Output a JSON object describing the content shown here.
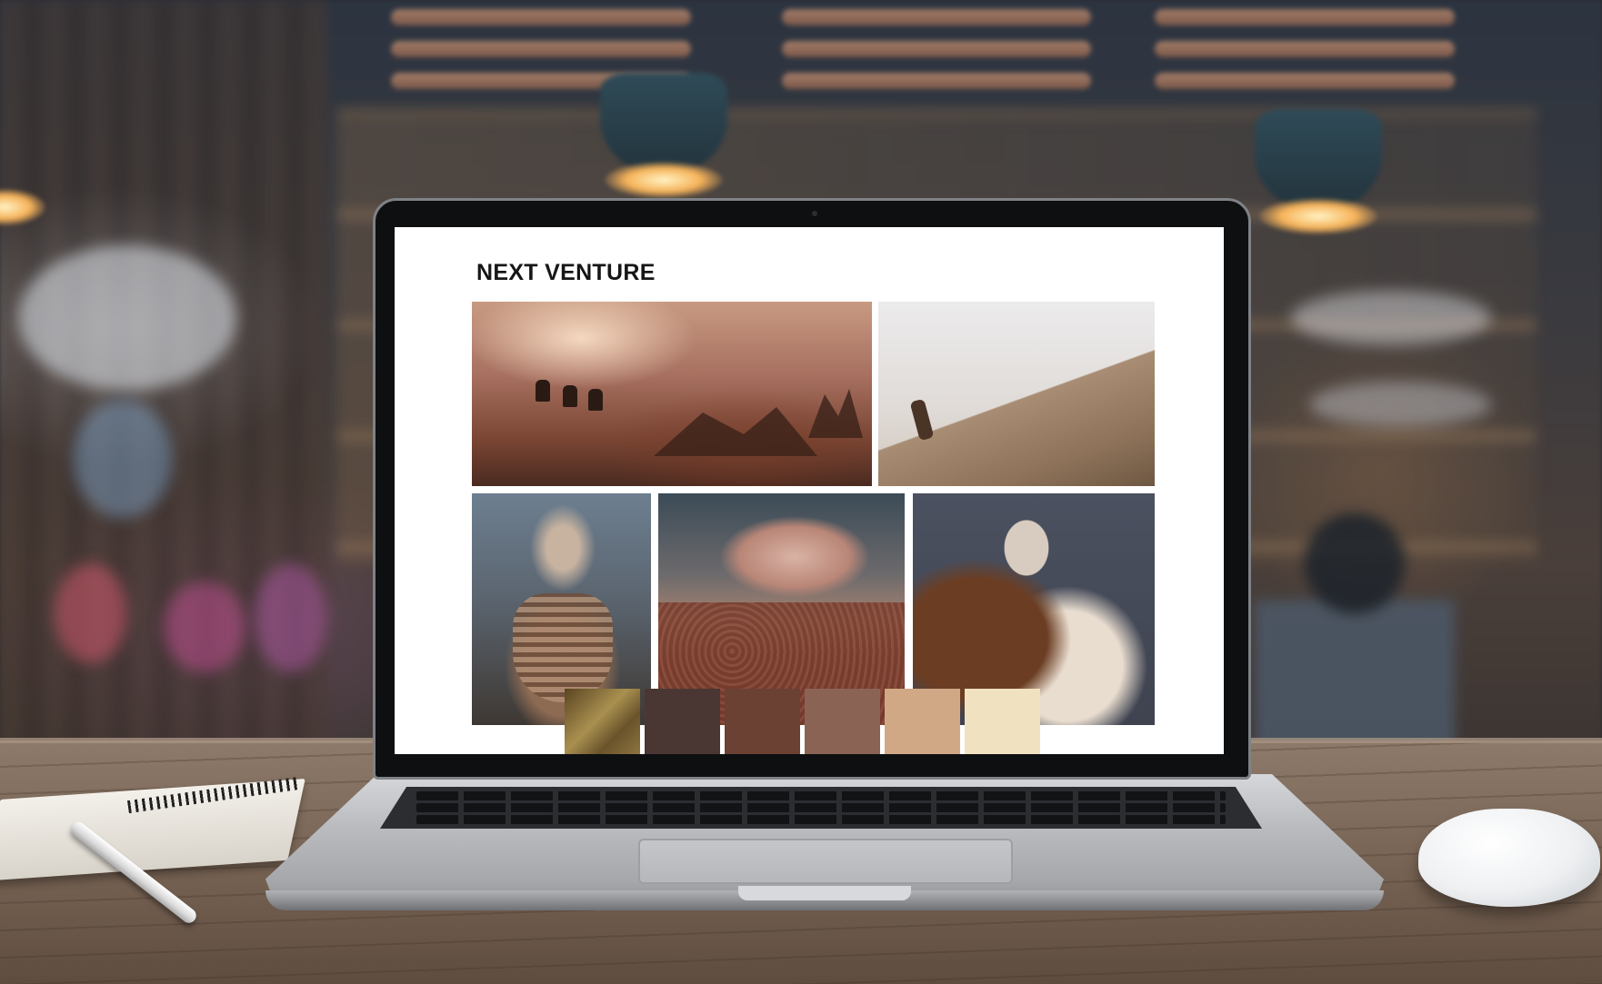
{
  "screen": {
    "title": "NEXT VENTURE"
  },
  "palette": {
    "swatches": [
      "#7a6236",
      "#4a3733",
      "#6b4133",
      "#8a6354",
      "#d1a886",
      "#f0e2c0"
    ]
  },
  "colors": {
    "screen_background": "#ffffff",
    "title_color": "#161616",
    "laptop_silver": "#b9bbbf",
    "desk_wood": "#7a6656"
  }
}
